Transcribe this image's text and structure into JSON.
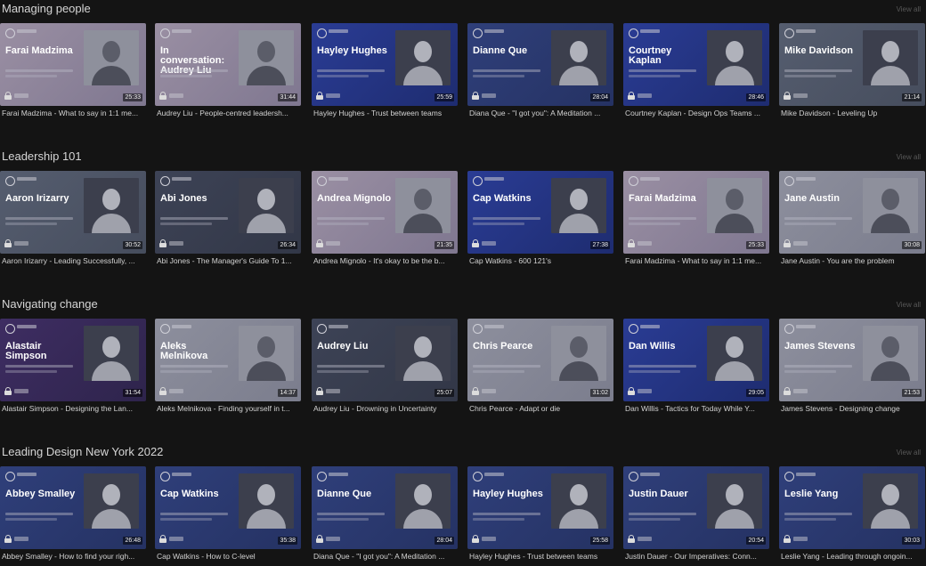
{
  "sections": [
    {
      "title": "Managing people",
      "view_all": "View all",
      "cards": [
        {
          "speaker": "Farai Madzima",
          "duration": "25:33",
          "title": "Farai Madzima - What to say in 1:1 me...",
          "theme": "t-pink"
        },
        {
          "speaker": "In conversation: Audrey Liu",
          "duration": "31:44",
          "title": "Audrey Liu - People-centred leadersh...",
          "theme": "t-pink"
        },
        {
          "speaker": "Hayley Hughes",
          "duration": "25:59",
          "title": "Hayley Hughes - Trust between teams",
          "theme": "t-blue"
        },
        {
          "speaker": "Dianne Que",
          "duration": "28:04",
          "title": "Diana Que - \"I got you\": A Meditation ...",
          "theme": "t-navy"
        },
        {
          "speaker": "Courtney Kaplan",
          "duration": "28:46",
          "title": "Courtney Kaplan - Design Ops Teams ...",
          "theme": "t-blue"
        },
        {
          "speaker": "Mike Davidson",
          "duration": "21:14",
          "title": "Mike Davidson - Leveling Up",
          "theme": "t-grey"
        }
      ]
    },
    {
      "title": "Leadership 101",
      "view_all": "View all",
      "cards": [
        {
          "speaker": "Aaron Irizarry",
          "duration": "30:52",
          "title": "Aaron Irizarry - Leading Successfully, ...",
          "theme": "t-grey"
        },
        {
          "speaker": "Abi Jones",
          "duration": "26:34",
          "title": "Abi Jones - The Manager's Guide To 1...",
          "theme": "t-slate"
        },
        {
          "speaker": "Andrea Mignolo",
          "duration": "21:35",
          "title": "Andrea Mignolo - It's okay to be the b...",
          "theme": "t-pink"
        },
        {
          "speaker": "Cap Watkins",
          "duration": "27:38",
          "title": "Cap Watkins - 600 121's",
          "theme": "t-blue"
        },
        {
          "speaker": "Farai Madzima",
          "duration": "25:33",
          "title": "Farai Madzima - What to say in 1:1 me...",
          "theme": "t-pink"
        },
        {
          "speaker": "Jane Austin",
          "duration": "30:08",
          "title": "Jane Austin - You are the problem",
          "theme": "t-light"
        }
      ]
    },
    {
      "title": "Navigating change",
      "view_all": "View all",
      "cards": [
        {
          "speaker": "Alastair Simpson",
          "duration": "31:54",
          "title": "Alastair Simpson - Designing the Lan...",
          "theme": "t-purple"
        },
        {
          "speaker": "Aleks Melnikova",
          "duration": "14:37",
          "title": "Aleks Melnikova - Finding yourself in t...",
          "theme": "t-light"
        },
        {
          "speaker": "Audrey Liu",
          "duration": "25:07",
          "title": "Audrey Liu - Drowning in Uncertainty",
          "theme": "t-slate"
        },
        {
          "speaker": "Chris Pearce",
          "duration": "31:02",
          "title": "Chris Pearce - Adapt or die",
          "theme": "t-light"
        },
        {
          "speaker": "Dan Willis",
          "duration": "29:05",
          "title": "Dan Willis - Tactics for Today While Y...",
          "theme": "t-blue"
        },
        {
          "speaker": "James Stevens",
          "duration": "21:53",
          "title": "James Stevens - Designing change",
          "theme": "t-light"
        }
      ]
    },
    {
      "title": "Leading Design New York 2022",
      "view_all": "View all",
      "cards": [
        {
          "speaker": "Abbey Smalley",
          "duration": "26:48",
          "title": "Abbey Smalley - How to find your righ...",
          "theme": "t-navy"
        },
        {
          "speaker": "Cap Watkins",
          "duration": "35:38",
          "title": "Cap Watkins - How to C-level",
          "theme": "t-navy"
        },
        {
          "speaker": "Dianne Que",
          "duration": "28:04",
          "title": "Diana Que - \"I got you\": A Meditation ...",
          "theme": "t-navy"
        },
        {
          "speaker": "Hayley Hughes",
          "duration": "25:58",
          "title": "Hayley Hughes - Trust between teams",
          "theme": "t-navy"
        },
        {
          "speaker": "Justin Dauer",
          "duration": "20:54",
          "title": "Justin Dauer - Our Imperatives: Conn...",
          "theme": "t-navy"
        },
        {
          "speaker": "Leslie Yang",
          "duration": "30:03",
          "title": "Leslie Yang - Leading through ongoin...",
          "theme": "t-navy"
        }
      ]
    }
  ],
  "icons": {
    "lock": "lock-icon"
  }
}
